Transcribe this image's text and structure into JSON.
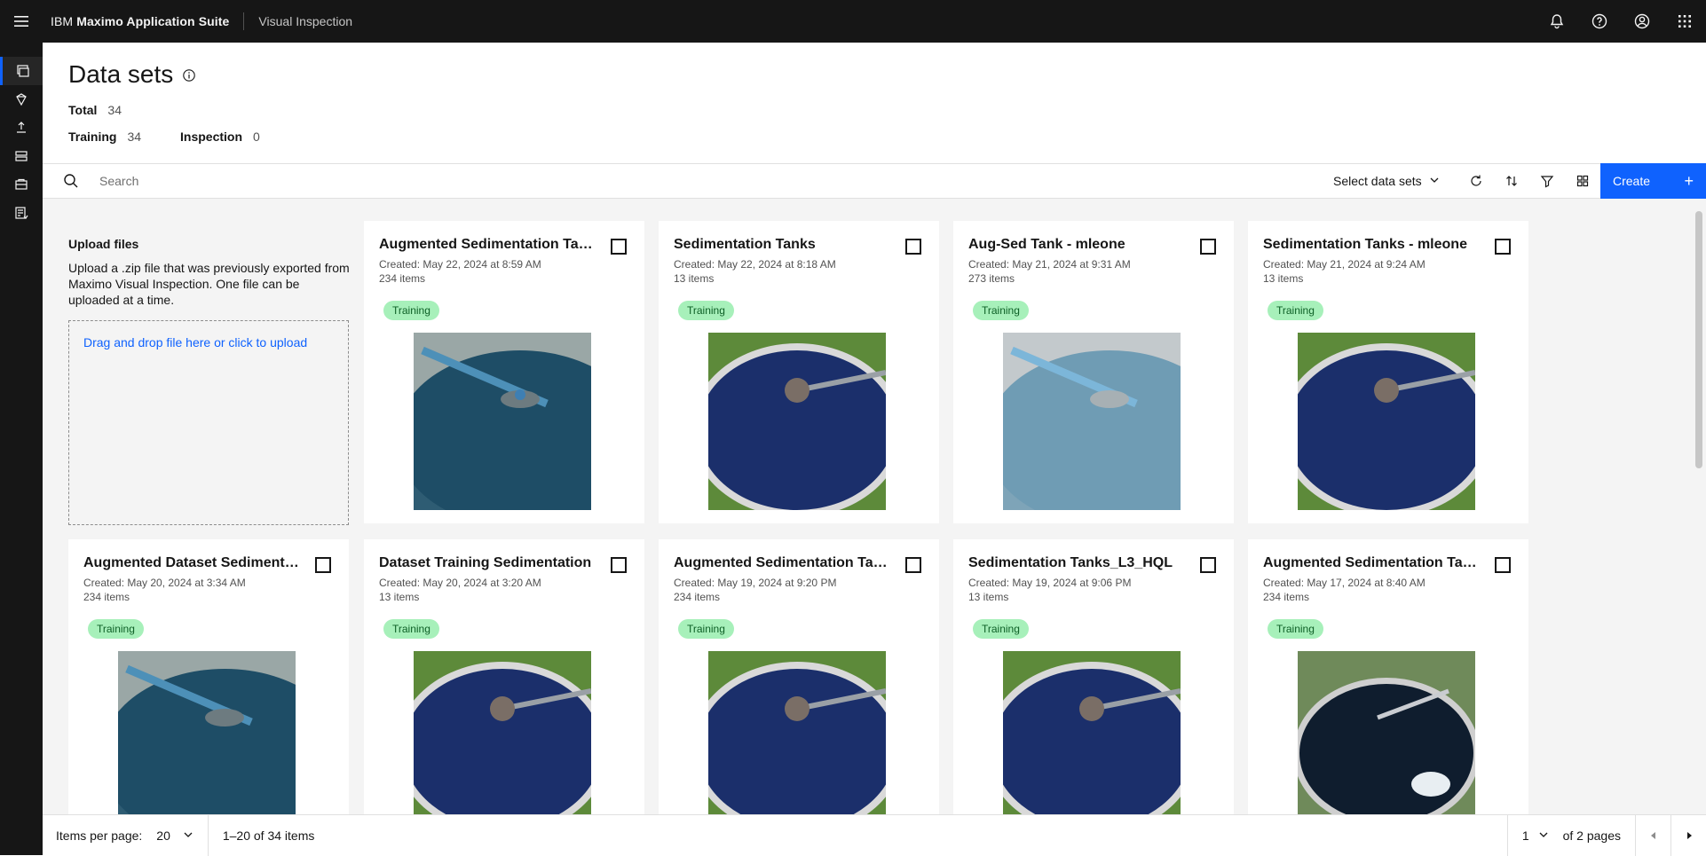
{
  "header": {
    "brand_prefix": "IBM ",
    "brand_bold": "Maximo Application Suite",
    "product": "Visual Inspection",
    "icons": [
      "notification-icon",
      "help-icon",
      "user-avatar-icon",
      "app-switcher-icon"
    ]
  },
  "rail": {
    "icons": [
      "datasets-icon",
      "models-icon",
      "deploy-icon",
      "projects-icon",
      "inspect-icon",
      "reports-icon"
    ]
  },
  "page": {
    "title": "Data sets",
    "total_label": "Total",
    "total_value": "34",
    "training_label": "Training",
    "training_value": "34",
    "inspection_label": "Inspection",
    "inspection_value": "0"
  },
  "toolbar": {
    "search_placeholder": "Search",
    "select_label": "Select data sets",
    "create_label": "Create",
    "create_plus": "+"
  },
  "upload": {
    "title": "Upload files",
    "description": "Upload a .zip file that was previously exported from Maximo Visual Inspection. One file can be uploaded at a time.",
    "drop_text": "Drag and drop file here or click to upload"
  },
  "cards": [
    {
      "title": "Augmented Sedimentation Tanks",
      "created": "Created: May 22, 2024 at 8:59 AM",
      "items": "234 items",
      "tag": "Training"
    },
    {
      "title": "Sedimentation Tanks",
      "created": "Created: May 22, 2024 at 8:18 AM",
      "items": "13 items",
      "tag": "Training"
    },
    {
      "title": "Aug-Sed Tank - mleone",
      "created": "Created: May 21, 2024 at 9:31 AM",
      "items": "273 items",
      "tag": "Training"
    },
    {
      "title": "Sedimentation Tanks - mleone",
      "created": "Created: May 21, 2024 at 9:24 AM",
      "items": "13 items",
      "tag": "Training"
    },
    {
      "title": "Augmented Dataset Sedimentation",
      "created": "Created: May 20, 2024 at 3:34 AM",
      "items": "234 items",
      "tag": "Training"
    },
    {
      "title": "Dataset Training Sedimentation",
      "created": "Created: May 20, 2024 at 3:20 AM",
      "items": "13 items",
      "tag": "Training"
    },
    {
      "title": "Augmented Sedimentation Tanks",
      "created": "Created: May 19, 2024 at 9:20 PM",
      "items": "234 items",
      "tag": "Training"
    },
    {
      "title": "Sedimentation Tanks_L3_HQL",
      "created": "Created: May 19, 2024 at 9:06 PM",
      "items": "13 items",
      "tag": "Training"
    },
    {
      "title": "Augmented Sedimentation Tanks",
      "created": "Created: May 17, 2024 at 8:40 AM",
      "items": "234 items",
      "tag": "Training"
    }
  ],
  "pagination": {
    "items_per_page_label": "Items per page:",
    "items_per_page_value": "20",
    "range": "1–20 of 34 items",
    "page_value": "1",
    "of_pages": "of 2 pages"
  },
  "colors": {
    "header_bg": "#161616",
    "accent": "#0f62fe",
    "tag_bg": "#a7f0ba",
    "tag_text": "#0e6027",
    "content_bg": "#f4f4f4"
  }
}
